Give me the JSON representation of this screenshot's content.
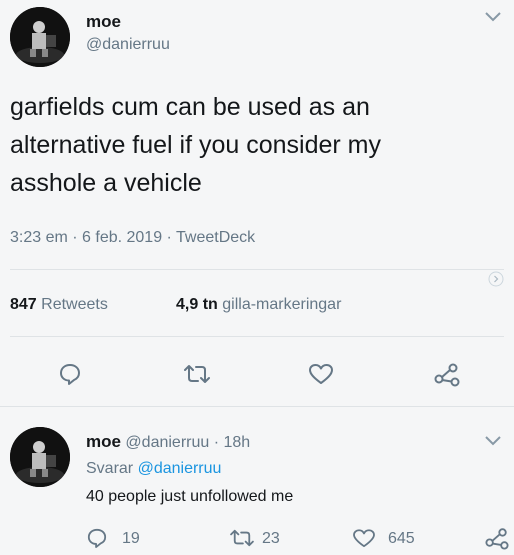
{
  "tweet": {
    "display_name": "moe",
    "handle": "@danierruu",
    "text_line1": "garfields cum can be used as an",
    "text_line2": "alternative fuel if you consider my",
    "text_line3": "asshole a vehicle",
    "timestamp": "3:23 em · 6 feb. 2019 · TweetDeck",
    "retweets_count": "847",
    "retweets_label": "Retweets",
    "likes_count": "4,9 tn",
    "likes_label": "gilla-markeringar"
  },
  "reply": {
    "display_name": "moe",
    "handle_time": "@danierruu · 18h",
    "replying_prefix": "Svarar ",
    "replying_to": "@danierruu",
    "text": "40 people just unfollowed me",
    "replies_count": "19",
    "retweets_count": "23",
    "likes_count": "645"
  },
  "colors": {
    "background": "#f5f6f7",
    "secondary_text": "#657786",
    "link": "#1b95e0"
  },
  "icons": [
    "chevron-down-icon",
    "reply-icon",
    "retweet-icon",
    "like-icon",
    "share-icon",
    "chevron-right-icon"
  ]
}
